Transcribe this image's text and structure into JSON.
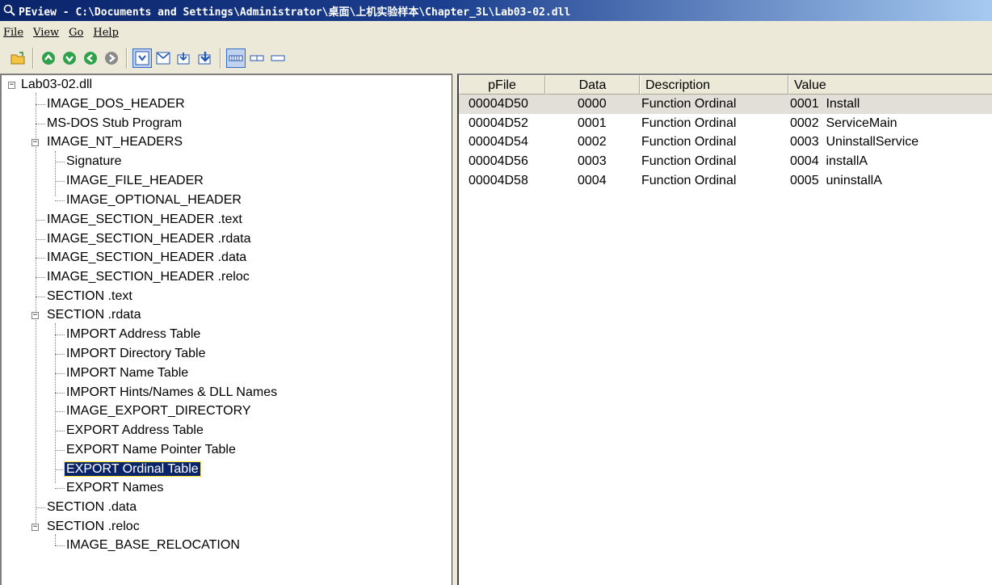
{
  "window": {
    "title": "PEview - C:\\Documents and Settings\\Administrator\\桌面\\上机实验样本\\Chapter_3L\\Lab03-02.dll"
  },
  "menu": [
    "File",
    "View",
    "Go",
    "Help"
  ],
  "toolbar": {
    "icons": [
      "open-icon",
      "back-icon",
      "forward-icon",
      "previous-icon",
      "next-icon",
      "view-hex-icon",
      "view-text-icon",
      "view-down-icon",
      "view-downbold-icon",
      "byte-view-icon",
      "word-view-icon",
      "dword-view-icon"
    ]
  },
  "tree": {
    "root": "Lab03-02.dll",
    "items": [
      {
        "label": "IMAGE_DOS_HEADER"
      },
      {
        "label": "MS-DOS Stub Program"
      },
      {
        "label": "IMAGE_NT_HEADERS"
      },
      {
        "label": "Signature"
      },
      {
        "label": "IMAGE_FILE_HEADER"
      },
      {
        "label": "IMAGE_OPTIONAL_HEADER"
      },
      {
        "label": "IMAGE_SECTION_HEADER .text"
      },
      {
        "label": "IMAGE_SECTION_HEADER .rdata"
      },
      {
        "label": "IMAGE_SECTION_HEADER .data"
      },
      {
        "label": "IMAGE_SECTION_HEADER .reloc"
      },
      {
        "label": "SECTION .text"
      },
      {
        "label": "SECTION .rdata"
      },
      {
        "label": "IMPORT Address Table"
      },
      {
        "label": "IMPORT Directory Table"
      },
      {
        "label": "IMPORT Name Table"
      },
      {
        "label": "IMPORT Hints/Names & DLL Names"
      },
      {
        "label": "IMAGE_EXPORT_DIRECTORY"
      },
      {
        "label": "EXPORT Address Table"
      },
      {
        "label": "EXPORT Name Pointer Table"
      },
      {
        "label": "EXPORT Ordinal Table"
      },
      {
        "label": "EXPORT Names"
      },
      {
        "label": "SECTION .data"
      },
      {
        "label": "SECTION .reloc"
      },
      {
        "label": "IMAGE_BASE_RELOCATION"
      }
    ],
    "selected": "EXPORT Ordinal Table"
  },
  "table": {
    "headers": [
      "pFile",
      "Data",
      "Description",
      "Value"
    ],
    "rows": [
      {
        "pfile": "00004D50",
        "data": "0000",
        "desc": "Function Ordinal",
        "value": "0001  Install"
      },
      {
        "pfile": "00004D52",
        "data": "0001",
        "desc": "Function Ordinal",
        "value": "0002  ServiceMain"
      },
      {
        "pfile": "00004D54",
        "data": "0002",
        "desc": "Function Ordinal",
        "value": "0003  UninstallService"
      },
      {
        "pfile": "00004D56",
        "data": "0003",
        "desc": "Function Ordinal",
        "value": "0004  installA"
      },
      {
        "pfile": "00004D58",
        "data": "0004",
        "desc": "Function Ordinal",
        "value": "0005  uninstallA"
      }
    ]
  },
  "colors": {
    "selection": "#0a246a",
    "title_gradient_start": "#0a246a",
    "title_gradient_end": "#a6caf0",
    "row_highlight": "#e1dfd8"
  }
}
